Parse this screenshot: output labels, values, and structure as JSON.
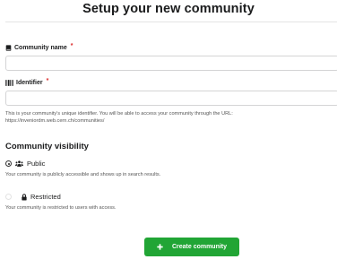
{
  "page": {
    "title": "Setup your new community"
  },
  "form": {
    "name_field": {
      "label": "Community name",
      "required_mark": "*",
      "value": "",
      "placeholder": "",
      "icon": "book-icon"
    },
    "identifier_field": {
      "label": "Identifier",
      "required_mark": "*",
      "value": "",
      "placeholder": "",
      "icon": "barcode-icon",
      "help_line1": "This is your community's unique identifier. You will be able to access your community through the URL:",
      "help_line2": "https://inveniordm.web.cern.ch/communities/"
    }
  },
  "visibility": {
    "title": "Community visibility",
    "options": [
      {
        "label": "Public",
        "icon": "users-icon",
        "description": "Your community is publicly accessible and shows up in search results.",
        "checked": true
      },
      {
        "label": "Restricted",
        "icon": "lock-icon",
        "description": "Your community is restricted to users with access.",
        "checked": false
      }
    ]
  },
  "actions": {
    "create_label": "Create community",
    "create_icon": "plus-icon",
    "button_color": "#21a535"
  }
}
